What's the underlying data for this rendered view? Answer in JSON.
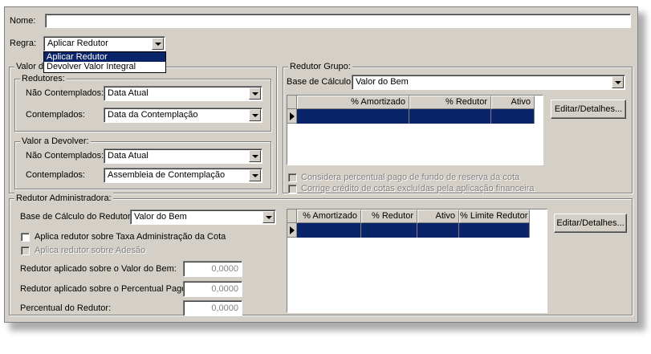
{
  "nome": {
    "label": "Nome:",
    "value": ""
  },
  "regra": {
    "label": "Regra:",
    "selected": "Aplicar Redutor",
    "options": [
      "Aplicar Redutor",
      "Devolver Valor Integral"
    ]
  },
  "valor_group": {
    "caption": "Valor d",
    "redutores": {
      "caption": "Redutores:",
      "nao_contemplados_label": "Não Contemplados:",
      "nao_contemplados_value": "Data Atual",
      "contemplados_label": "Contemplados:",
      "contemplados_value": "Data da Contemplação"
    },
    "devolver": {
      "caption": "Valor a Devolver:",
      "nao_contemplados_label": "Não Contemplados:",
      "nao_contemplados_value": "Data Atual",
      "contemplados_label": "Contemplados:",
      "contemplados_value": "Assembleia de Contemplação"
    }
  },
  "redutor_grupo": {
    "caption": "Redutor Grupo:",
    "base_label": "Base de Cálculo:",
    "base_value": "Valor do Bem",
    "columns": [
      "% Amortizado",
      "% Redutor",
      "Ativo"
    ],
    "button": "Editar/Detalhes...",
    "check1": "Considera percentual pago de fundo de reserva da cota",
    "check2": "Corrige crédito de cotas excluídas pela aplicação financeira"
  },
  "redutor_adm": {
    "caption": "Redutor Administradora:",
    "base_label": "Base de Cálculo do Redutor:",
    "base_value": "Valor do Bem",
    "check_taxa": "Aplica redutor sobre Taxa Administração da Cota",
    "check_adesao": "Aplica redutor sobre Adesão",
    "valor_bem_label": "Redutor aplicado sobre o Valor do Bem:",
    "valor_bem_value": "0,0000",
    "perc_pago_label": "Redutor aplicado sobre o Percentual Pago:",
    "perc_pago_value": "0,0000",
    "perc_redutor_label": "Percentual do Redutor:",
    "perc_redutor_value": "0,0000",
    "columns": [
      "% Amortizado",
      "% Redutor",
      "Ativo",
      "% Limite Redutor"
    ],
    "button": "Editar/Detalhes..."
  },
  "colors": {
    "panel": "#d4d0c8",
    "selection": "#0a246a"
  },
  "icons": [
    "dropdown-arrow-icon",
    "row-indicator-icon"
  ]
}
